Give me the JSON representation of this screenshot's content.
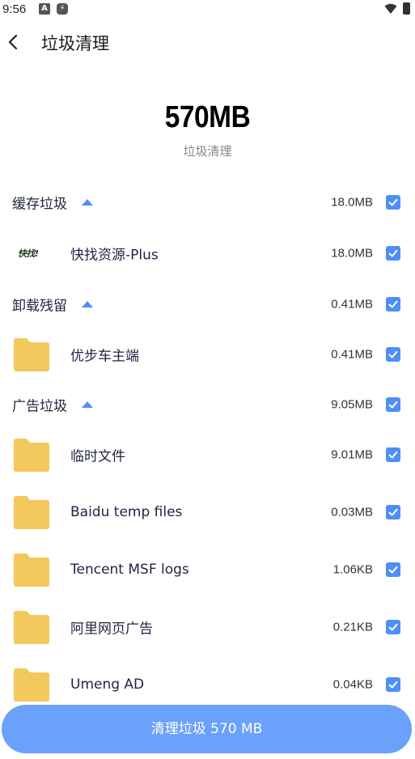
{
  "status_bar": {
    "time": "9:56"
  },
  "header": {
    "title": "垃圾清理"
  },
  "summary": {
    "total_size": "570MB",
    "label": "垃圾清理"
  },
  "accent_color": "#4f8ef7",
  "folder_color": "#f3c85c",
  "groups": [
    {
      "name": "缓存垃圾",
      "size": "18.0MB",
      "checked": true,
      "expanded": true,
      "items": [
        {
          "name": "快找资源-Plus",
          "size": "18.0MB",
          "icon": "app-logo",
          "logo_text": "快找!",
          "checked": true
        }
      ]
    },
    {
      "name": "卸载残留",
      "size": "0.41MB",
      "checked": true,
      "expanded": true,
      "items": [
        {
          "name": "优步车主端",
          "size": "0.41MB",
          "icon": "folder-icon",
          "checked": true
        }
      ]
    },
    {
      "name": "广告垃圾",
      "size": "9.05MB",
      "checked": true,
      "expanded": true,
      "items": [
        {
          "name": "临时文件",
          "size": "9.01MB",
          "icon": "folder-icon",
          "checked": true
        },
        {
          "name": "Baidu temp files",
          "size": "0.03MB",
          "icon": "folder-icon",
          "checked": true
        },
        {
          "name": "Tencent MSF logs",
          "size": "1.06KB",
          "icon": "folder-icon",
          "checked": true
        },
        {
          "name": "阿里网页广告",
          "size": "0.21KB",
          "icon": "folder-icon",
          "checked": true
        },
        {
          "name": "Umeng AD",
          "size": "0.04KB",
          "icon": "folder-icon",
          "checked": true
        }
      ]
    }
  ],
  "clean_button": {
    "label": "清理垃圾 570 MB"
  }
}
